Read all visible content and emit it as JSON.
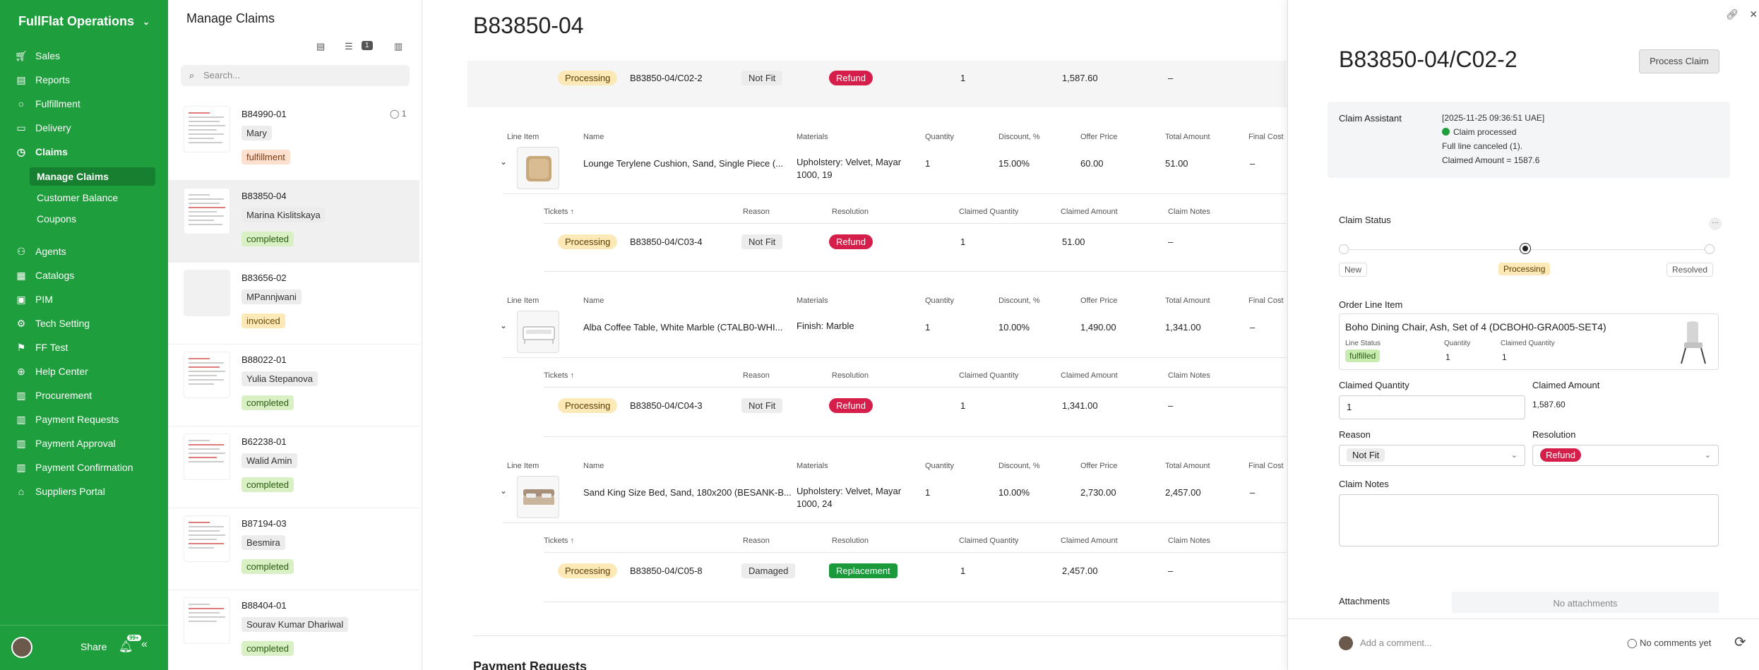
{
  "sidebar": {
    "brand": "FullFlat Operations",
    "items": [
      {
        "label": "Sales",
        "icon": "cart-icon"
      },
      {
        "label": "Reports",
        "icon": "chart-icon"
      },
      {
        "label": "Fulfillment",
        "icon": "circle-icon"
      },
      {
        "label": "Delivery",
        "icon": "truck-icon"
      },
      {
        "label": "Claims",
        "icon": "clock-icon"
      },
      {
        "label": "Agents",
        "icon": "agents-icon"
      },
      {
        "label": "Catalogs",
        "icon": "catalog-icon"
      },
      {
        "label": "PIM",
        "icon": "pim-icon"
      },
      {
        "label": "Tech Setting",
        "icon": "tech-icon"
      },
      {
        "label": "FF Test",
        "icon": "test-icon"
      },
      {
        "label": "Help Center",
        "icon": "help-icon"
      },
      {
        "label": "Procurement",
        "icon": "procurement-icon"
      },
      {
        "label": "Payment Requests",
        "icon": "payment-icon"
      },
      {
        "label": "Payment Approval",
        "icon": "approval-icon"
      },
      {
        "label": "Payment Confirmation",
        "icon": "confirm-icon"
      },
      {
        "label": "Suppliers Portal",
        "icon": "portal-icon"
      }
    ],
    "subitems": [
      "Manage Claims",
      "Customer Balance",
      "Coupons"
    ],
    "share": "Share",
    "notif_badge": "99+"
  },
  "list": {
    "title": "Manage Claims",
    "filter_count": "1",
    "search_placeholder": "Search...",
    "claims": [
      {
        "id": "B84990-01",
        "user": "Mary",
        "status": "fulfillment",
        "comments": "1"
      },
      {
        "id": "B83850-04",
        "user": "Marina Kislitskaya",
        "status": "completed"
      },
      {
        "id": "B83656-02",
        "user": "MPannjwani",
        "status": "invoiced"
      },
      {
        "id": "B88022-01",
        "user": "Yulia Stepanova",
        "status": "completed"
      },
      {
        "id": "B62238-01",
        "user": "Walid Amin",
        "status": "completed"
      },
      {
        "id": "B87194-03",
        "user": "Besmira",
        "status": "completed"
      },
      {
        "id": "B88404-01",
        "user": "Sourav Kumar Dhariwal",
        "status": "completed"
      }
    ]
  },
  "main": {
    "title": "B83850-04",
    "headers": {
      "line_item": "Line Item",
      "name": "Name",
      "materials": "Materials",
      "quantity": "Quantity",
      "discount": "Discount, %",
      "offer_price": "Offer Price",
      "total_amount": "Total Amount",
      "final_cost": "Final Cost",
      "tickets": "Tickets ↑",
      "reason": "Reason",
      "resolution": "Resolution",
      "claimed_quantity": "Claimed Quantity",
      "claimed_amount": "Claimed Amount",
      "claim_notes": "Claim Notes"
    },
    "top_ticket": {
      "status": "Processing",
      "ticket": "B83850-04/C02-2",
      "reason": "Not Fit",
      "resolution": "Refund",
      "qty": "1",
      "amount": "1,587.60",
      "notes": "–"
    },
    "lines": [
      {
        "name": "Lounge Terylene Cushion, Sand, Single Piece (...",
        "materials": [
          "Upholstery: Velvet, Mayar",
          "1000, 19"
        ],
        "quantity": "1",
        "discount": "15.00%",
        "offer_price": "60.00",
        "total": "51.00",
        "final_cost": "–",
        "ticket": {
          "status": "Processing",
          "id": "B83850-04/C03-4",
          "reason": "Not Fit",
          "resolution": "Refund",
          "qty": "1",
          "amount": "51.00",
          "notes": "–"
        }
      },
      {
        "name": "Alba Coffee Table, White Marble (CTALB0-WHI...",
        "materials": [
          "Finish: Marble",
          ""
        ],
        "quantity": "1",
        "discount": "10.00%",
        "offer_price": "1,490.00",
        "total": "1,341.00",
        "final_cost": "–",
        "ticket": {
          "status": "Processing",
          "id": "B83850-04/C04-3",
          "reason": "Not Fit",
          "resolution": "Refund",
          "qty": "1",
          "amount": "1,341.00",
          "notes": "–"
        }
      },
      {
        "name": "Sand King Size Bed, Sand, 180x200 (BESANK-B...",
        "materials": [
          "Upholstery: Velvet, Mayar",
          "1000, 24"
        ],
        "quantity": "1",
        "discount": "10.00%",
        "offer_price": "2,730.00",
        "total": "2,457.00",
        "final_cost": "–",
        "ticket": {
          "status": "Processing",
          "id": "B83850-04/C05-8",
          "reason": "Damaged",
          "resolution": "Replacement",
          "qty": "1",
          "amount": "2,457.00",
          "notes": "–"
        }
      }
    ],
    "payment_requests": "Payment Requests"
  },
  "panel": {
    "title": "B83850-04/C02-2",
    "process_button": "Process Claim",
    "assistant": {
      "label": "Claim Assistant",
      "lines": [
        "[2025-11-25 09:36:51 UAE]",
        "Claim processed",
        "Full line canceled (1).",
        "Claimed Amount = 1587.6"
      ]
    },
    "claim_status": {
      "label": "Claim Status",
      "steps": [
        "New",
        "Processing",
        "Resolved"
      ],
      "current": "Processing"
    },
    "order_line": {
      "label": "Order Line Item",
      "name": "Boho Dining Chair, Ash, Set of 4 (DCBOH0-GRA005-SET4)",
      "line_status_label": "Line Status",
      "line_status": "fulfilled",
      "quantity_label": "Quantity",
      "quantity": "1",
      "claimed_qty_label": "Claimed Quantity",
      "claimed_qty": "1"
    },
    "claimed_quantity_label": "Claimed Quantity",
    "claimed_quantity": "1",
    "claimed_amount_label": "Claimed Amount",
    "claimed_amount": "1,587.60",
    "reason_label": "Reason",
    "reason": "Not Fit",
    "resolution_label": "Resolution",
    "resolution": "Refund",
    "notes_label": "Claim Notes",
    "attachments_label": "Attachments",
    "no_attachments": "No attachments",
    "comment_placeholder": "Add a comment...",
    "no_comments": "No comments yet"
  }
}
